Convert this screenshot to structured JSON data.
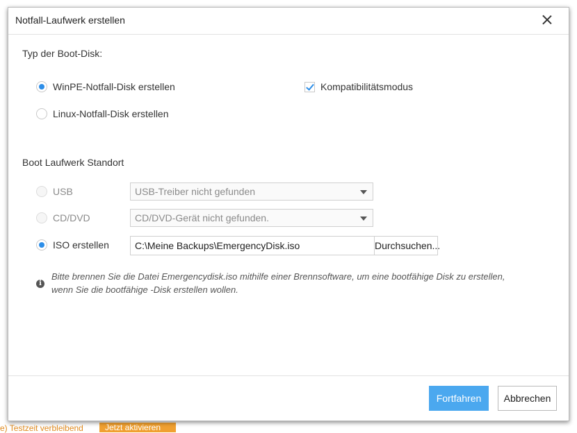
{
  "background": {
    "status_text": "e) Testzeit verbleibend",
    "activate_label": "Jetzt aktivieren"
  },
  "dialog": {
    "title": "Notfall-Laufwerk erstellen",
    "close_icon": "close-icon"
  },
  "boot_type": {
    "heading": "Typ der Boot-Disk:",
    "options": [
      {
        "label": "WinPE-Notfall-Disk erstellen",
        "selected": true
      },
      {
        "label": "Linux-Notfall-Disk erstellen",
        "selected": false
      }
    ],
    "compat_mode": {
      "label": "Kompatibilitätsmodus",
      "checked": true
    }
  },
  "location": {
    "heading": "Boot Laufwerk Standort",
    "usb": {
      "label": "USB",
      "select_value": "USB-Treiber nicht gefunden",
      "enabled": false
    },
    "cddvd": {
      "label": "CD/DVD",
      "select_value": "CD/DVD-Gerät nicht gefunden.",
      "enabled": false
    },
    "iso": {
      "label": "ISO erstellen",
      "path_value": "C:\\Meine Backups\\EmergencyDisk.iso",
      "browse_label": "Durchsuchen...",
      "selected": true
    }
  },
  "info": {
    "icon": "info-icon",
    "line1": "Bitte brennen Sie die Datei Emergencydisk.iso mithilfe einer Brennsoftware, um eine bootfähige Disk zu erstellen,",
    "line2": "wenn Sie die bootfähige -Disk erstellen wollen."
  },
  "footer": {
    "continue_label": "Fortfahren",
    "cancel_label": "Abbrechen"
  },
  "colors": {
    "accent": "#2d8ee8",
    "primary_button": "#4ba8ef",
    "trial_orange": "#f0a030"
  }
}
